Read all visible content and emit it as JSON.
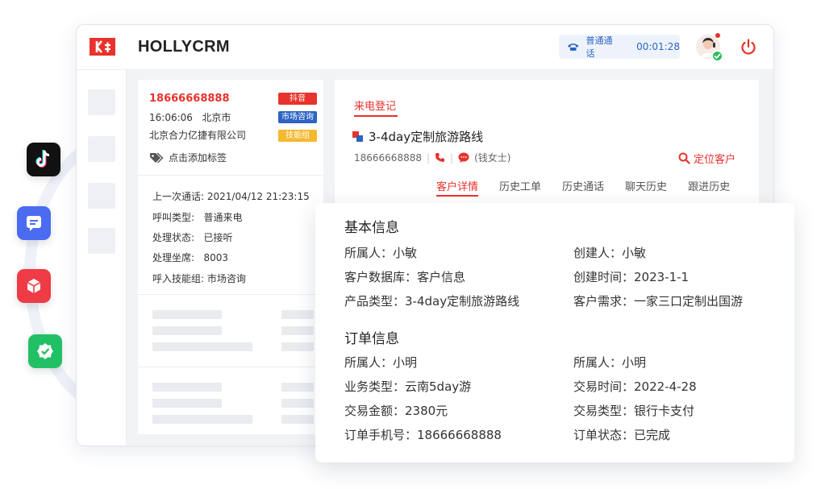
{
  "side_apps": [
    {
      "name": "douyin",
      "color": "#111111"
    },
    {
      "name": "message",
      "color": "#4b6bf0"
    },
    {
      "name": "box",
      "color": "#ef3b46"
    },
    {
      "name": "verified",
      "color": "#22c065"
    }
  ],
  "header": {
    "brand": "HOLLYCRM",
    "call_type": "普通通话",
    "call_timer": "00:01:28"
  },
  "caller": {
    "phone": "18666668888",
    "time": "16:06:06",
    "city": "北京市",
    "company": "北京合力亿捷有限公司",
    "add_tag": "点击添加标签",
    "badges": [
      {
        "label": "抖音",
        "color": "#e8322c"
      },
      {
        "label": "市场咨询",
        "color": "#2c63c4"
      },
      {
        "label": "技能组",
        "color": "#f5b82e"
      }
    ]
  },
  "call_details": [
    {
      "label": "上一次通话:",
      "value": "2021/04/12 21:23:15"
    },
    {
      "label": "呼叫类型:",
      "value": "普通来电"
    },
    {
      "label": "处理状态:",
      "value": "已接听"
    },
    {
      "label": "处理坐席:",
      "value": "8003"
    },
    {
      "label": "呼入技能组:",
      "value": "市场咨询"
    }
  ],
  "main": {
    "reg_tab": "来电登记",
    "product_title": "3-4day定制旅游路线",
    "contact_phone": "18666668888",
    "contact_name": "(钱女士)",
    "locate_button": "定位客户",
    "tabs": [
      "客户详情",
      "历史工单",
      "历史通话",
      "聊天历史",
      "跟进历史"
    ]
  },
  "popup": {
    "basic_title": "基本信息",
    "basic_fields": [
      "所属人：小敏",
      "创建人：小敏",
      "客户数据库：客户信息",
      "创建时间：2023-1-1",
      "产品类型：3-4day定制旅游路线",
      "客户需求：一家三口定制出国游"
    ],
    "order_title": "订单信息",
    "order_fields": [
      "所属人：小明",
      "所属人：小明",
      "业务类型：云南5day游",
      "交易时间：2022-4-28",
      "交易金额：2380元",
      "交易类型：银行卡支付",
      "订单手机号：18666668888",
      "订单状态：已完成"
    ]
  }
}
